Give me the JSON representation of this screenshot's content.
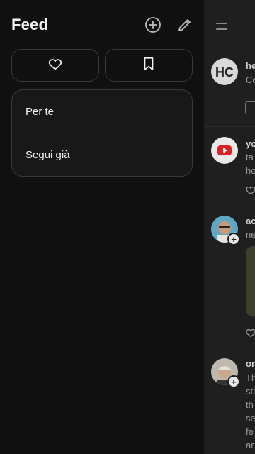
{
  "drawer": {
    "title": "Feed",
    "icons": {
      "add": "plus-circle-icon",
      "edit": "pencil-icon"
    },
    "pills": {
      "favorites": "heart-icon",
      "saved": "bookmark-icon"
    },
    "menu": [
      {
        "label": "Per te"
      },
      {
        "label": "Segui già"
      }
    ]
  },
  "feed": {
    "menu_icon": "menu-icon",
    "posts": [
      {
        "user": "he",
        "text_lines": [
          "Co"
        ]
      },
      {
        "user": "yo",
        "text_lines": [
          "ta",
          "ho"
        ]
      },
      {
        "user": "ac",
        "text_lines": [
          "ne"
        ]
      },
      {
        "user": "on",
        "text_lines": [
          "Th",
          "sta",
          "th",
          "se",
          "fe",
          "ar"
        ]
      }
    ]
  },
  "colors": {
    "background": "#101010",
    "overlay": "#1f1f1f",
    "border": "#3a3a3a",
    "text": "#f3f3f3"
  }
}
